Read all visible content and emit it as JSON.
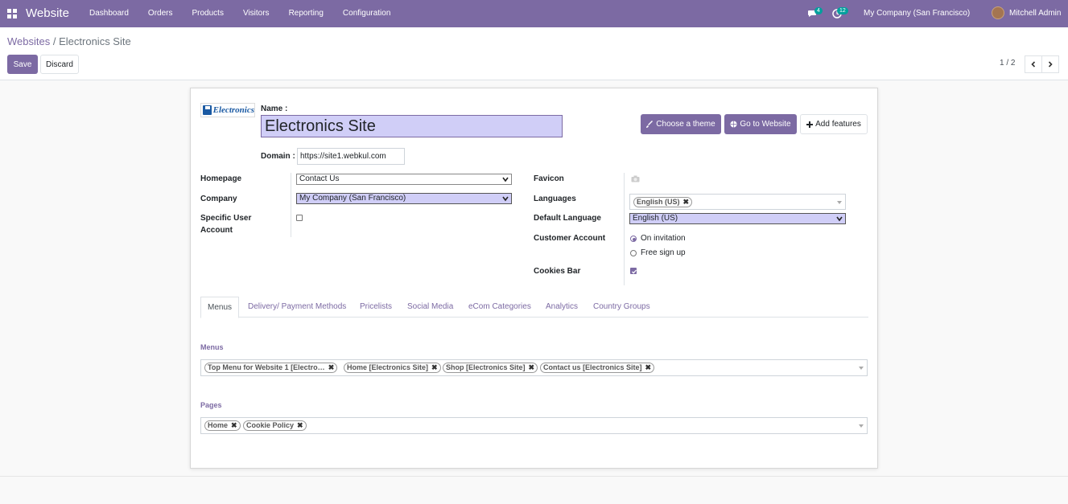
{
  "navbar": {
    "app_title": "Website",
    "menu": [
      "Dashboard",
      "Orders",
      "Products",
      "Visitors",
      "Reporting",
      "Configuration"
    ],
    "messages_count": "4",
    "activities_count": "12",
    "company": "My Company (San Francisco)",
    "user": "Mitchell Admin"
  },
  "breadcrumb": {
    "parent": "Websites",
    "separator": "/",
    "current": "Electronics Site"
  },
  "buttons": {
    "save": "Save",
    "discard": "Discard",
    "choose_theme": "Choose a theme",
    "go_to_website": "Go to Website",
    "add_features": "Add features"
  },
  "pager": "1 / 2",
  "form": {
    "logo_text": "Electronics",
    "name_label": "Name :",
    "name_value": "Electronics Site",
    "domain_label": "Domain :",
    "domain_value": "https://site1.webkul.com",
    "homepage_label": "Homepage",
    "homepage_value": "Contact Us",
    "company_label": "Company",
    "company_value": "My Company (San Francisco)",
    "specific_user_label_1": "Specific User",
    "specific_user_label_2": "Account",
    "specific_user_checked": false,
    "favicon_label": "Favicon",
    "languages_label": "Languages",
    "languages_tags": [
      "English (US)"
    ],
    "default_language_label": "Default Language",
    "default_language_value": "English (US)",
    "customer_account_label": "Customer Account",
    "customer_account_options": [
      "On invitation",
      "Free sign up"
    ],
    "customer_account_selected": "On invitation",
    "cookies_bar_label": "Cookies Bar",
    "cookies_bar_checked": true
  },
  "tabs": [
    "Menus",
    "Delivery/ Payment Methods",
    "Pricelists",
    "Social Media",
    "eCom Categories",
    "Analytics",
    "Country Groups"
  ],
  "active_tab": "Menus",
  "menus_section": {
    "title": "Menus",
    "tags": [
      "Top Menu for Website 1 [Electro…",
      "Home [Electronics Site]",
      "Shop [Electronics Site]",
      "Contact us [Electronics Site]"
    ]
  },
  "pages_section": {
    "title": "Pages",
    "tags": [
      "Home",
      "Cookie Policy"
    ]
  },
  "colors": {
    "brand": "#7c6aa3",
    "badge": "#00a09d",
    "highlight": "#d0cef7"
  }
}
